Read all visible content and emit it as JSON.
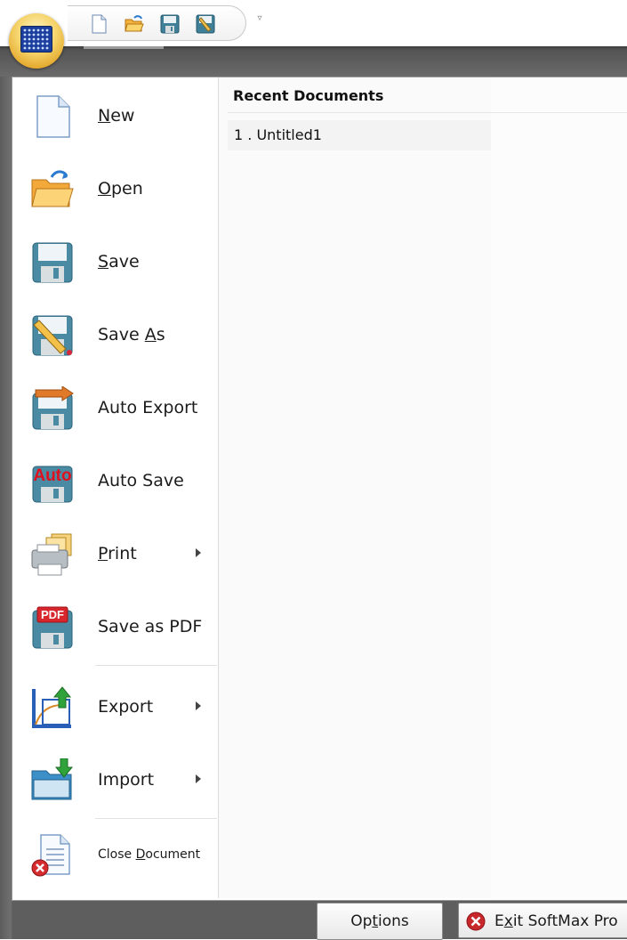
{
  "quick_access": {
    "items": [
      "new-icon",
      "open-icon",
      "save-icon",
      "save-as-icon"
    ],
    "dropdown_glyph": "▿"
  },
  "menu": {
    "items": [
      {
        "pre": "",
        "key": "N",
        "post": "ew"
      },
      {
        "pre": "",
        "key": "O",
        "post": "pen"
      },
      {
        "pre": "",
        "key": "S",
        "post": "ave"
      },
      {
        "pre": "Save ",
        "key": "A",
        "post": "s"
      },
      {
        "label": "Auto Export"
      },
      {
        "label": "Auto Save"
      },
      {
        "pre": "",
        "key": "P",
        "post": "rint"
      },
      {
        "label": "Save as PDF"
      },
      {
        "label": "Export"
      },
      {
        "label": "Import"
      },
      {
        "pre": "Close ",
        "key": "D",
        "post": "ocument"
      }
    ],
    "auto_badge": "Auto",
    "pdf_badge": "PDF"
  },
  "recent": {
    "title": "Recent Documents",
    "items": [
      "1 . Untitled1"
    ]
  },
  "buttons": {
    "options": {
      "pre": "Op",
      "key": "t",
      "post": "ions"
    },
    "exit": {
      "pre": "E",
      "key": "x",
      "post": "it SoftMax Pro"
    }
  },
  "colors": {
    "orb": "#e8b030",
    "frame": "#5c5c5c",
    "exit_red": "#c8282b"
  }
}
